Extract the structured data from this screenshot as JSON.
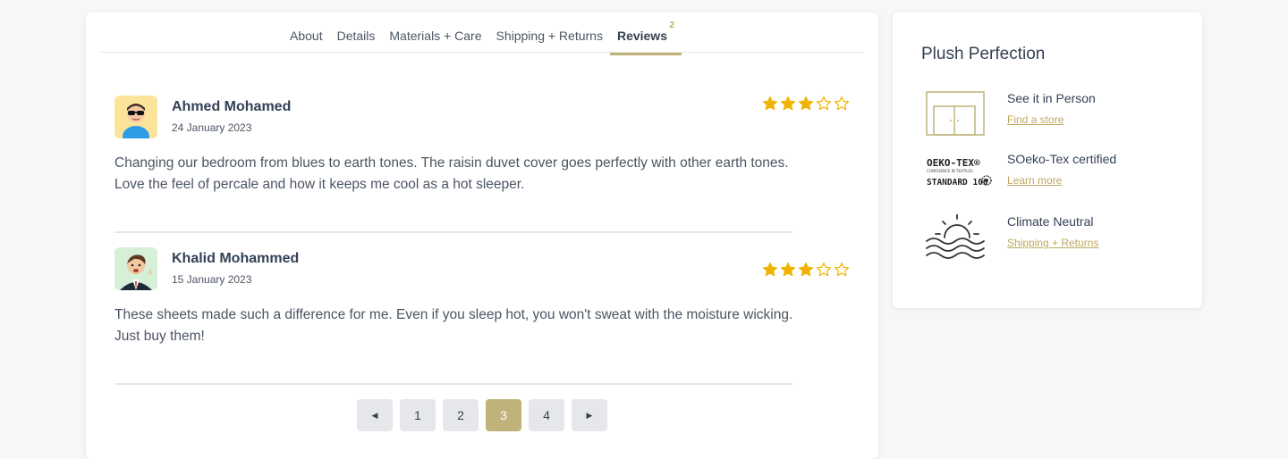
{
  "tabs": [
    {
      "label": "About"
    },
    {
      "label": "Details"
    },
    {
      "label": "Materials + Care"
    },
    {
      "label": "Shipping + Returns"
    },
    {
      "label": "Reviews",
      "badge": "2",
      "active": true
    }
  ],
  "reviews": [
    {
      "name": "Ahmed Mohamed",
      "date": "24 January 2023",
      "rating": 3,
      "max_rating": 5,
      "text": "Changing our bedroom from blues to earth tones. The raisin duvet cover goes perfectly with other earth tones. Love the feel of percale and how it keeps me cool as a hot sleeper."
    },
    {
      "name": "Khalid Mohammed",
      "date": "15 January 2023",
      "rating": 3,
      "max_rating": 5,
      "text": "These sheets made such a difference for me. Even if you sleep hot, you won't sweat with the moisture wicking. Just buy them!"
    }
  ],
  "pagination": {
    "pages": [
      "1",
      "2",
      "3",
      "4"
    ],
    "current": "3",
    "prev_icon": "caret-left-icon",
    "next_icon": "caret-right-icon"
  },
  "sidebar": {
    "title": "Plush Perfection",
    "features": [
      {
        "title": "See it in Person",
        "link": "Find a store",
        "icon": "store-door-icon"
      },
      {
        "title": "SOeko-Tex certified",
        "link": "Learn more",
        "icon": "oeko-tex-logo",
        "logo_text": [
          "OEKO-TEX®",
          "CONFIDENCE IN TEXTILES",
          "STANDARD 100"
        ]
      },
      {
        "title": "Climate Neutral",
        "link": "Shipping + Returns",
        "icon": "sunset-waves-icon"
      }
    ]
  },
  "colors": {
    "accent": "#bfb27a",
    "star": "#f0b400",
    "link": "#bfa860"
  }
}
